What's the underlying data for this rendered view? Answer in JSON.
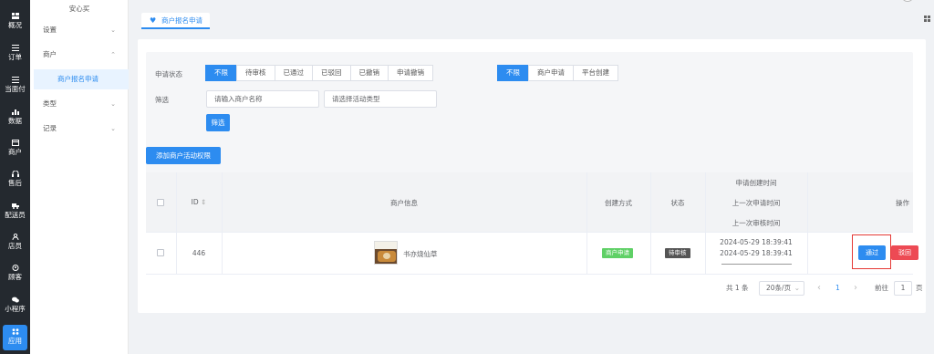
{
  "rail": {
    "items": [
      {
        "label": "概况",
        "icon": "dashboard-icon"
      },
      {
        "label": "订单",
        "icon": "order-list-icon"
      },
      {
        "label": "当面付",
        "icon": "face-pay-icon"
      },
      {
        "label": "数据",
        "icon": "data-chart-icon"
      },
      {
        "label": "商户",
        "icon": "merchant-store-icon"
      },
      {
        "label": "售后",
        "icon": "headset-icon"
      },
      {
        "label": "配送员",
        "icon": "delivery-icon"
      },
      {
        "label": "店员",
        "icon": "staff-icon"
      },
      {
        "label": "顾客",
        "icon": "customer-icon"
      },
      {
        "label": "小程序",
        "icon": "mini-program-icon"
      },
      {
        "label": "应用",
        "icon": "apps-grid-icon",
        "active": true
      }
    ]
  },
  "submenu": {
    "shop_name": "安心买",
    "items": [
      {
        "label": "设置",
        "chevron": "⌄"
      },
      {
        "label": "商户",
        "chevron": "⌃"
      },
      {
        "label": "商户报名申请",
        "selected": true
      },
      {
        "label": "类型",
        "chevron": "⌄"
      },
      {
        "label": "记录",
        "chevron": "⌄"
      }
    ]
  },
  "tabbar": {
    "active_tab": "商户报名申请"
  },
  "filter": {
    "status_label": "申请状态",
    "status_options": [
      "不限",
      "待审核",
      "已通过",
      "已驳回",
      "已撤销",
      "申请撤销"
    ],
    "status_selected": "不限",
    "source_options": [
      "不限",
      "商户申请",
      "平台创建"
    ],
    "source_selected": "不限",
    "filter_label": "筛选",
    "merchant_placeholder": "请输入商户名称",
    "activity_placeholder": "请选择活动类型",
    "filter_button": "筛选"
  },
  "add_button": "添加商户活动权限",
  "table": {
    "headers": {
      "id": "ID",
      "sort_icon": "⇕",
      "merchant_info": "商户信息",
      "create_method": "创建方式",
      "status": "状态",
      "time_1": "申请创建时间",
      "time_2": "上一次申请时间",
      "time_3": "上一次审核时间",
      "actions": "操作"
    },
    "rows": [
      {
        "id": "446",
        "merchant_name": "书亦烧仙草",
        "thumb_caption": "书亦·烧仙草",
        "create_method": "商户申请",
        "status": "待审核",
        "created_at": "2024-05-29 18:39:41",
        "last_applied_at": "2024-05-29 18:39:41",
        "last_reviewed_at": "",
        "approve_label": "通过",
        "reject_label": "驳回"
      }
    ]
  },
  "pagination": {
    "total": "共 1 条",
    "page_size": "20条/页",
    "prev": "‹",
    "current_page": "1",
    "next": "›",
    "goto_label": "前往",
    "goto_value": "1",
    "page_suffix": "页"
  },
  "colors": {
    "primary": "#2d8cf0",
    "rail_bg": "#24292f",
    "success_tag": "#5fd066",
    "danger": "#ed4a54",
    "highlight_border": "#e53935"
  }
}
